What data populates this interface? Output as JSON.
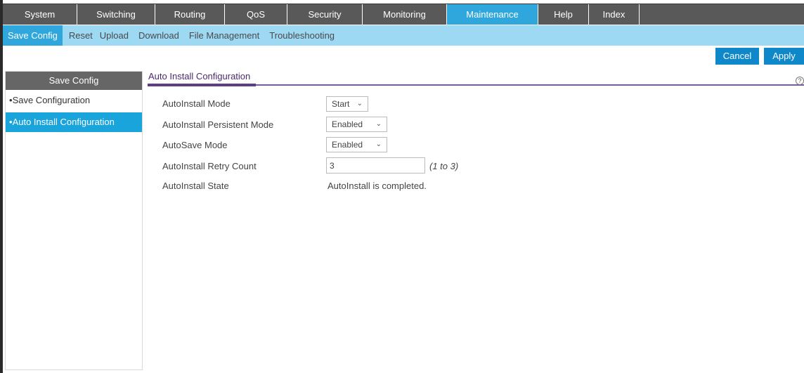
{
  "topnav": {
    "tabs": [
      {
        "label": "System"
      },
      {
        "label": "Switching"
      },
      {
        "label": "Routing"
      },
      {
        "label": "QoS"
      },
      {
        "label": "Security"
      },
      {
        "label": "Monitoring"
      },
      {
        "label": "Maintenance"
      },
      {
        "label": "Help"
      },
      {
        "label": "Index"
      }
    ],
    "active": "Maintenance"
  },
  "subnav": {
    "items": [
      {
        "label": "Save Config"
      },
      {
        "label": "Reset"
      },
      {
        "label": "Upload"
      },
      {
        "label": "Download"
      },
      {
        "label": "File Management"
      },
      {
        "label": "Troubleshooting"
      }
    ],
    "active": "Save Config"
  },
  "actions": {
    "cancel_label": "Cancel",
    "apply_label": "Apply"
  },
  "sidebar": {
    "header": "Save Config",
    "items": [
      {
        "label": "Save Configuration"
      },
      {
        "label": "Auto Install Configuration"
      }
    ],
    "active": "Auto Install Configuration"
  },
  "main": {
    "title": "Auto Install Configuration",
    "help_icon": "help-icon",
    "fields": {
      "autoinstall_mode": {
        "label": "AutoInstall Mode",
        "value": "Start"
      },
      "persistent_mode": {
        "label": "AutoInstall Persistent Mode",
        "value": "Enabled"
      },
      "autosave_mode": {
        "label": "AutoSave Mode",
        "value": "Enabled"
      },
      "retry_count": {
        "label": "AutoInstall Retry Count",
        "value": "3",
        "hint": "(1 to 3)"
      },
      "state": {
        "label": "AutoInstall State",
        "value": "AutoInstall is completed."
      }
    }
  },
  "colors": {
    "nav_bg": "#595959",
    "accent_blue": "#2fa7dc",
    "subnav_bg": "#9dd9f3",
    "button_blue": "#0e88c9",
    "title_purple": "#5c3f82"
  }
}
